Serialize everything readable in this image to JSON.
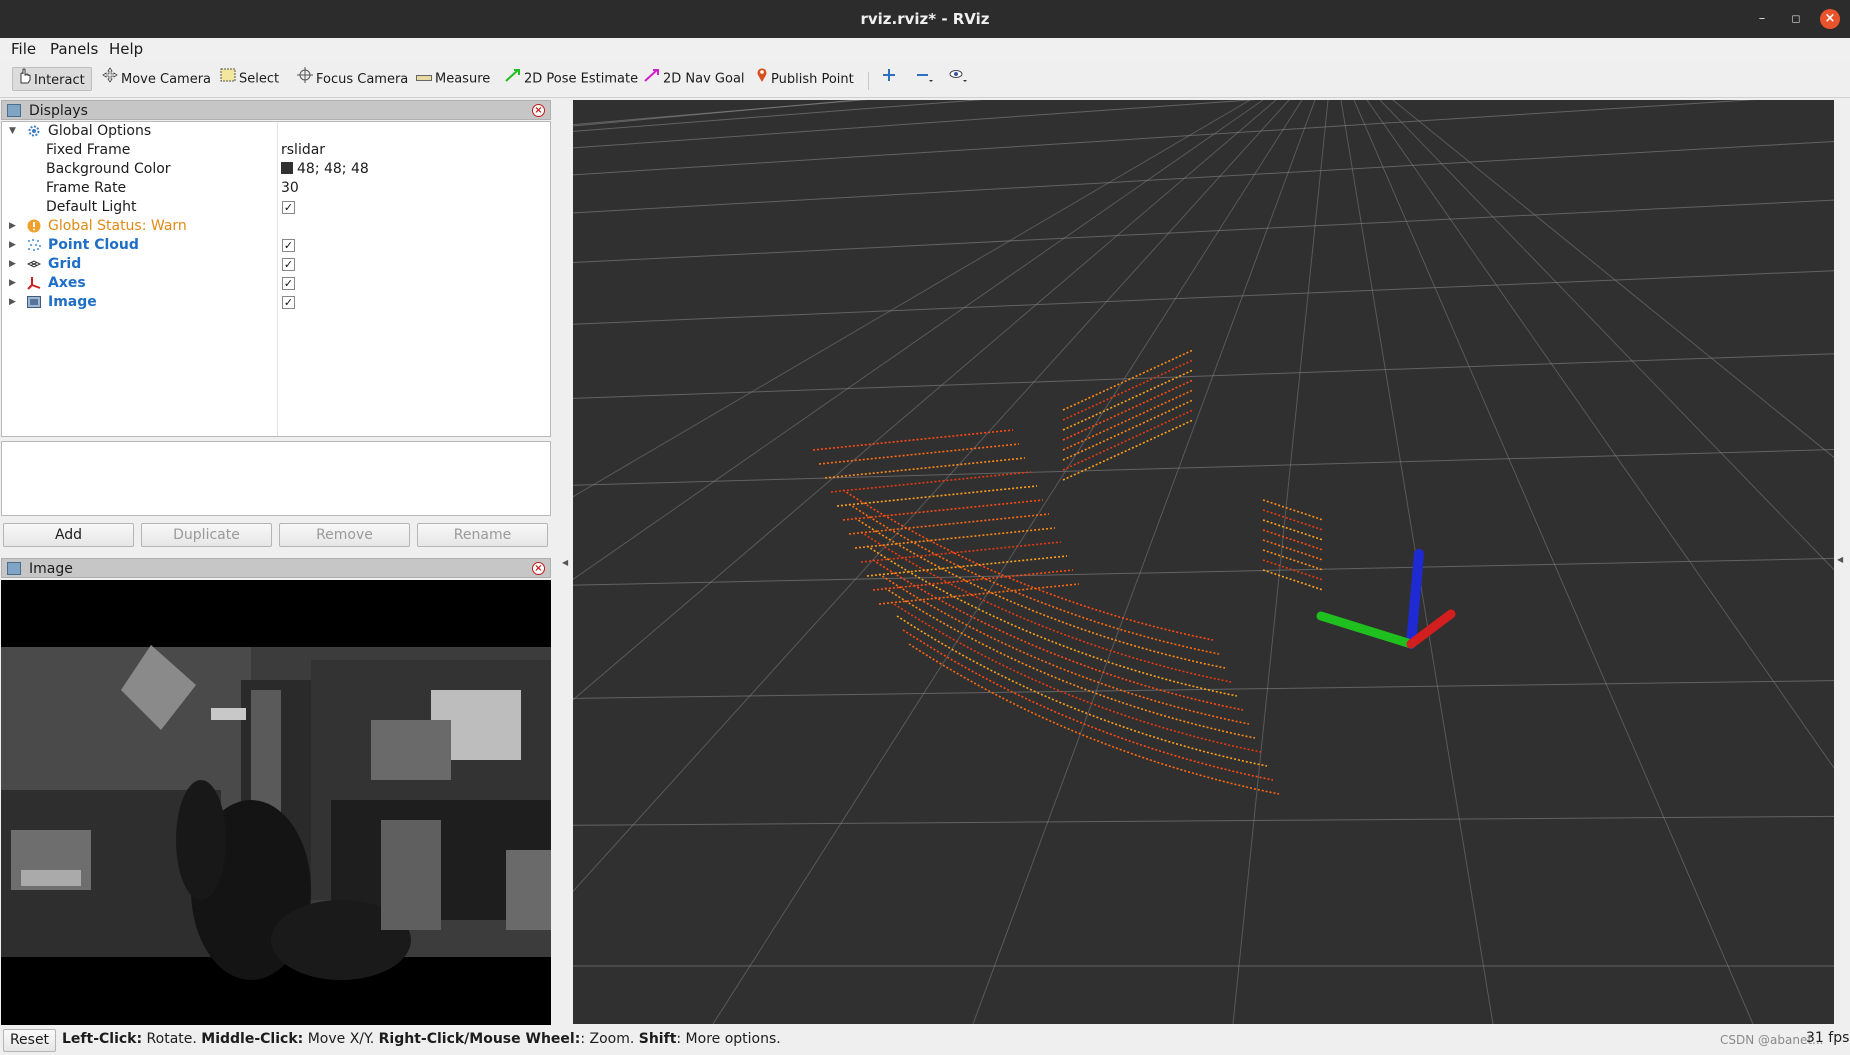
{
  "window": {
    "title": "rviz.rviz* - RViz"
  },
  "menu": [
    "File",
    "Panels",
    "Help"
  ],
  "toolbar": {
    "interact": "Interact",
    "move_camera": "Move Camera",
    "select": "Select",
    "focus_camera": "Focus Camera",
    "measure": "Measure",
    "pose_estimate": "2D Pose Estimate",
    "nav_goal": "2D Nav Goal",
    "publish_point": "Publish Point"
  },
  "displays_panel": {
    "title": "Displays",
    "global_options": {
      "label": "Global Options",
      "fixed_frame": {
        "label": "Fixed Frame",
        "value": "rslidar"
      },
      "background_color": {
        "label": "Background Color",
        "value": "48; 48; 48",
        "color": "#303030"
      },
      "frame_rate": {
        "label": "Frame Rate",
        "value": "30"
      },
      "default_light": {
        "label": "Default Light",
        "checked": true
      }
    },
    "global_status": {
      "label": "Global Status: Warn"
    },
    "displays": [
      {
        "label": "Point Cloud",
        "icon": "point-cloud-icon",
        "checked": true
      },
      {
        "label": "Grid",
        "icon": "grid-icon",
        "checked": true
      },
      {
        "label": "Axes",
        "icon": "axes-icon",
        "checked": true
      },
      {
        "label": "Image",
        "icon": "image-icon",
        "checked": true
      }
    ],
    "buttons": {
      "add": "Add",
      "duplicate": "Duplicate",
      "remove": "Remove",
      "rename": "Rename"
    }
  },
  "image_panel": {
    "title": "Image"
  },
  "status_bar": {
    "reset": "Reset",
    "hint_left_key": "Left-Click:",
    "hint_left_text": " Rotate. ",
    "hint_middle_key": "Middle-Click:",
    "hint_middle_text": " Move X/Y. ",
    "hint_right_key": "Right-Click/Mouse Wheel:",
    "hint_right_text": ": Zoom. ",
    "hint_shift_key": "Shift",
    "hint_shift_text": ": More options.",
    "fps": "31 fps",
    "watermark": "CSDN @abanet..."
  },
  "colors": {
    "viewport_bg": "#303030",
    "link_blue": "#1f6fc6",
    "warn_orange": "#e08a14",
    "axis_x": "#d21e1e",
    "axis_y": "#1fbf1f",
    "axis_z": "#1f2ad2"
  }
}
